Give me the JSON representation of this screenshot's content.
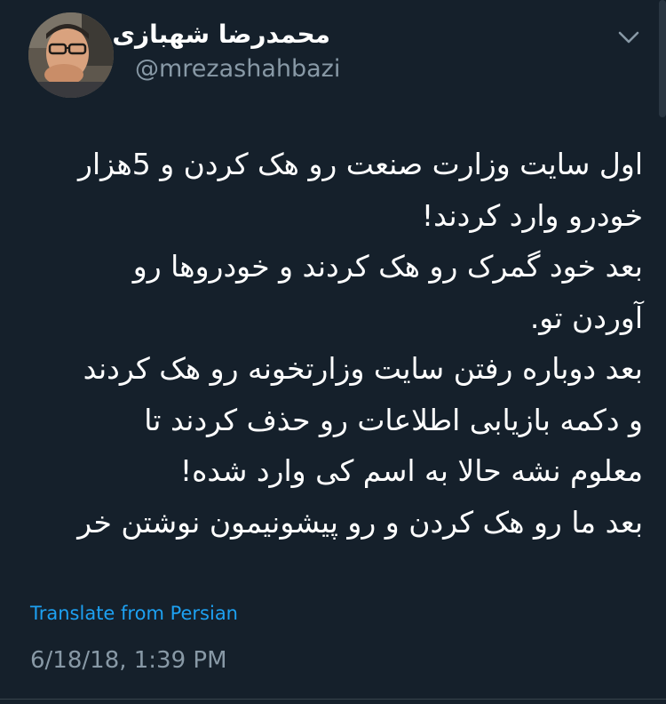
{
  "author": {
    "display_name": "محمدرضا شهبازی",
    "handle": "@mrezashahbazi",
    "avatar_icon": "person-photo-avatar"
  },
  "menu": {
    "icon": "chevron-down-icon"
  },
  "tweet": {
    "lines": [
      "اول سایت وزارت صنعت رو هک کردن و 5هزار",
      "خودرو وارد کردند!",
      "بعد خود گمرک رو هک کردند و خودروها رو",
      "آوردن تو.",
      "بعد دوباره رفتن سایت وزارتخونه رو هک کردند",
      "و دکمه بازیابی اطلاعات رو حذف کردند تا",
      "معلوم نشه حالا به اسم کی وارد شده!",
      "بعد ما رو هک کردن و رو پیشونیمون نوشتن خر"
    ],
    "translate_label": "Translate from Persian",
    "timestamp": "6/18/18, 1:39 PM"
  },
  "colors": {
    "background": "#15202b",
    "text": "#ffffff",
    "secondary": "#8899a6",
    "link": "#1da1f2"
  }
}
